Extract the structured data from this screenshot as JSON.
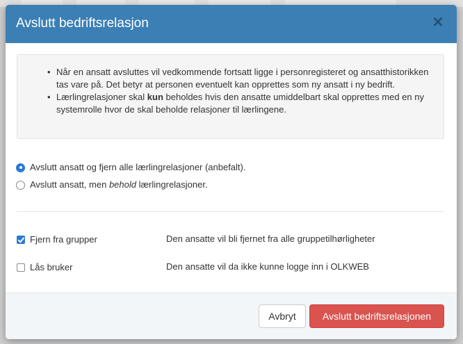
{
  "modal": {
    "title": "Avslutt bedriftsrelasjon",
    "close_symbol": "×"
  },
  "info": {
    "items": [
      {
        "text": "Når en ansatt avsluttes vil vedkommende fortsatt ligge i personregisteret og ansatthistorikken tas vare på. Det betyr at personen eventuelt kan opprettes som ny ansatt i ny bedrift."
      },
      {
        "text_before": "Lærlingrelasjoner skal ",
        "text_bold": "kun",
        "text_after": " beholdes hvis den ansatte umiddelbart skal opprettes med en ny systemrolle hvor de skal beholde relasjoner til lærlingene."
      }
    ]
  },
  "options": {
    "remove_relations": {
      "label": "Avslutt ansatt og fjern alle lærlingrelasjoner (anbefalt).",
      "selected": true
    },
    "keep_relations": {
      "label_before": "Avslutt ansatt, men ",
      "label_emphasis": "behold",
      "label_after": " lærlingrelasjoner.",
      "selected": false
    }
  },
  "checks": {
    "remove_groups": {
      "label": "Fjern fra grupper",
      "description": "Den ansatte vil bli fjernet fra alle gruppetilhørligheter",
      "checked": true
    },
    "lock_user": {
      "label": "Lås bruker",
      "description": "Den ansatte vil da ikke kunne logge inn i OLKWEB",
      "checked": false
    }
  },
  "footer": {
    "cancel_label": "Avbryt",
    "confirm_label": "Avslutt bedriftsrelasjonen"
  },
  "colors": {
    "header": "#3c7fb4",
    "primary_check": "#2b79d6",
    "danger": "#d9534f"
  }
}
